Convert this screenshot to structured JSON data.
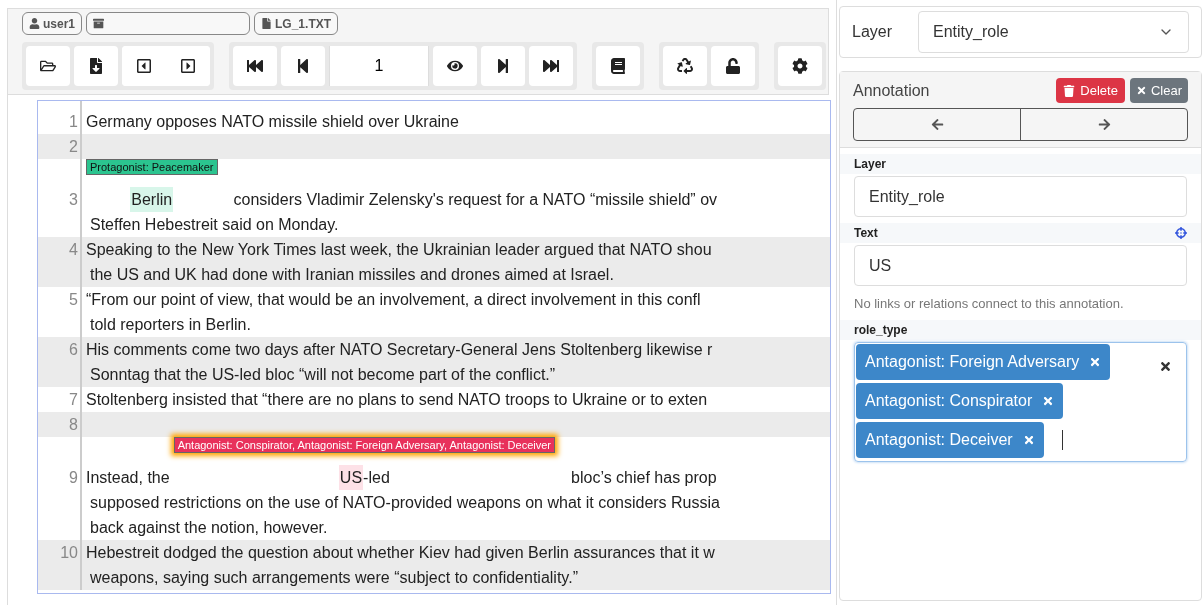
{
  "toolbar": {
    "badges": [
      {
        "kind": "user",
        "label": "user1"
      },
      {
        "kind": "project"
      },
      {
        "kind": "document",
        "label": "LG_1.TXT"
      }
    ],
    "page_field": {
      "value": "1"
    }
  },
  "editor": {
    "lines": [
      {
        "number": "1",
        "rows": [
          [
            {
              "text": "Germany opposes NATO missile shield over Ukraine"
            }
          ]
        ]
      },
      {
        "number": "2",
        "rows": [
          []
        ]
      },
      {
        "number": "3",
        "rows": [
          [
            {
              "text": "Berlin",
              "label": "Protagonist: Peacemaker",
              "color": "#2bc48f",
              "selected": false
            },
            {
              "text": "considers Vladimir Zelensky's request for a NATO “missile shield” ov"
            }
          ],
          [
            {
              "text": "Steffen Hebestreit said on Monday."
            }
          ]
        ]
      },
      {
        "number": "4",
        "rows": [
          [
            {
              "text": "Speaking to the New York Times last week, the Ukrainian leader argued that NATO shou"
            }
          ],
          [
            {
              "text": "the US and UK had done with Iranian missiles and drones aimed at Israel."
            }
          ]
        ]
      },
      {
        "number": "5",
        "rows": [
          [
            {
              "text": "“From our point of view, that would be an involvement, a direct involvement in this confl"
            }
          ],
          [
            {
              "text": "told reporters in Berlin."
            }
          ]
        ]
      },
      {
        "number": "6",
        "rows": [
          [
            {
              "text": "His comments come two days after NATO Secretary-General Jens Stoltenberg likewise r"
            }
          ],
          [
            {
              "text": "Sonntag that the US-led bloc “will not become part of the conflict.”"
            }
          ]
        ]
      },
      {
        "number": "7",
        "rows": [
          [
            {
              "text": "Stoltenberg insisted that “there are no plans to send NATO troops to Ukraine or to exten"
            }
          ]
        ]
      },
      {
        "number": "8",
        "rows": [
          []
        ]
      },
      {
        "number": "9",
        "rows": [
          [
            {
              "text": "Instead, the"
            },
            {
              "text": "US",
              "trailing": "-led",
              "label": "Antagonist: Conspirator, Antagonist: Foreign Adversary, Antagonist: Deceiver",
              "color": "#e8315b",
              "selected": true
            },
            {
              "text": "bloc’s chief has prop"
            }
          ],
          [
            {
              "text": "supposed restrictions on the use of NATO-provided weapons on what it considers Russia"
            }
          ],
          [
            {
              "text": "back against the notion, however."
            }
          ]
        ]
      },
      {
        "number": "10",
        "rows": [
          [
            {
              "text": "Hebestreit dodged the question about whether Kiev had given Berlin assurances that it w"
            }
          ],
          [
            {
              "text": "weapons, saying such arrangements were “subject to confidentiality.”"
            }
          ]
        ]
      }
    ]
  },
  "side": {
    "layer_select": {
      "label": "Layer",
      "value": "Entity_role"
    },
    "annotation": {
      "title": "Annotation",
      "delete": "Delete",
      "clear": "Clear",
      "fields": [
        {
          "kind": "text",
          "label": "Layer",
          "value": "Entity_role"
        },
        {
          "kind": "text",
          "label": "Text",
          "value": "US",
          "locate": true
        },
        {
          "kind": "note",
          "text": "No links or relations connect to this annotation."
        },
        {
          "kind": "tags",
          "label": "role_type",
          "tags": [
            "Antagonist: Foreign Adversary",
            "Antagonist: Conspirator",
            "Antagonist: Deceiver"
          ]
        }
      ]
    }
  }
}
